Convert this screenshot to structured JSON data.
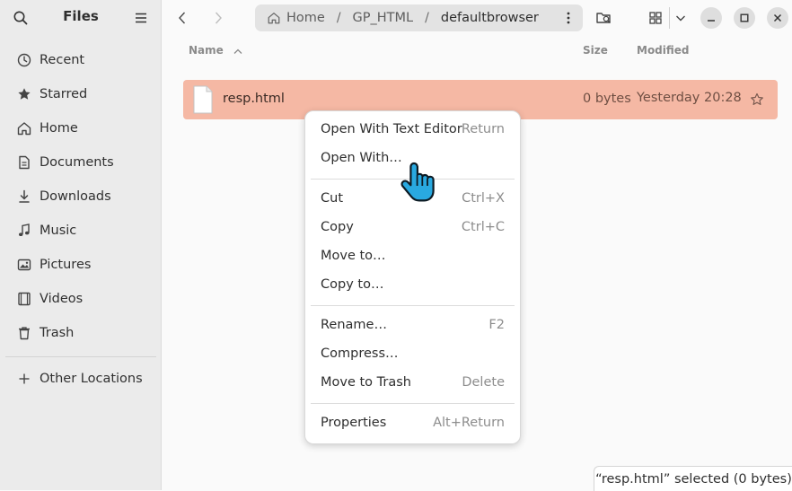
{
  "sidebar": {
    "title": "Files",
    "search_icon": "search-icon",
    "menu_icon": "hamburger-menu-icon",
    "items": [
      {
        "label": "Recent",
        "icon": "clock-icon"
      },
      {
        "label": "Starred",
        "icon": "star-icon"
      },
      {
        "label": "Home",
        "icon": "home-icon"
      },
      {
        "label": "Documents",
        "icon": "document-icon"
      },
      {
        "label": "Downloads",
        "icon": "download-icon"
      },
      {
        "label": "Music",
        "icon": "music-note-icon"
      },
      {
        "label": "Pictures",
        "icon": "picture-icon"
      },
      {
        "label": "Videos",
        "icon": "video-icon"
      },
      {
        "label": "Trash",
        "icon": "trash-icon"
      }
    ],
    "other_locations": {
      "label": "Other Locations",
      "icon": "plus-icon"
    }
  },
  "header": {
    "back_icon": "chevron-left-icon",
    "forward_icon": "chevron-right-icon",
    "path": [
      {
        "label": "Home",
        "icon": "home-icon"
      },
      {
        "label": "GP_HTML"
      },
      {
        "label": "defaultbrowser"
      }
    ],
    "path_separator": "/",
    "path_menu_icon": "vertical-dots-icon",
    "search_folder_icon": "folder-search-icon",
    "view_icon": "grid-view-icon",
    "view_menu_icon": "chevron-down-icon",
    "window_controls": [
      "minimize-icon",
      "maximize-icon",
      "close-icon"
    ]
  },
  "columns": {
    "name": "Name",
    "size": "Size",
    "modified": "Modified"
  },
  "files": [
    {
      "name": "resp.html",
      "size": "0 bytes",
      "modified": "Yesterday 20:28",
      "selected": true
    }
  ],
  "context_menu": {
    "groups": [
      [
        {
          "label": "Open With Text Editor",
          "shortcut": "Return"
        },
        {
          "label": "Open With…",
          "shortcut": ""
        }
      ],
      [
        {
          "label": "Cut",
          "shortcut": "Ctrl+X"
        },
        {
          "label": "Copy",
          "shortcut": "Ctrl+C"
        },
        {
          "label": "Move to…",
          "shortcut": ""
        },
        {
          "label": "Copy to…",
          "shortcut": ""
        }
      ],
      [
        {
          "label": "Rename…",
          "shortcut": "F2"
        },
        {
          "label": "Compress…",
          "shortcut": ""
        },
        {
          "label": "Move to Trash",
          "shortcut": "Delete"
        }
      ],
      [
        {
          "label": "Properties",
          "shortcut": "Alt+Return"
        }
      ]
    ]
  },
  "status": "“resp.html” selected  (0 bytes)",
  "colors": {
    "selection": "#f5b8a4",
    "sidebar_bg": "#ebebeb",
    "cursor": "#29a9e0"
  }
}
